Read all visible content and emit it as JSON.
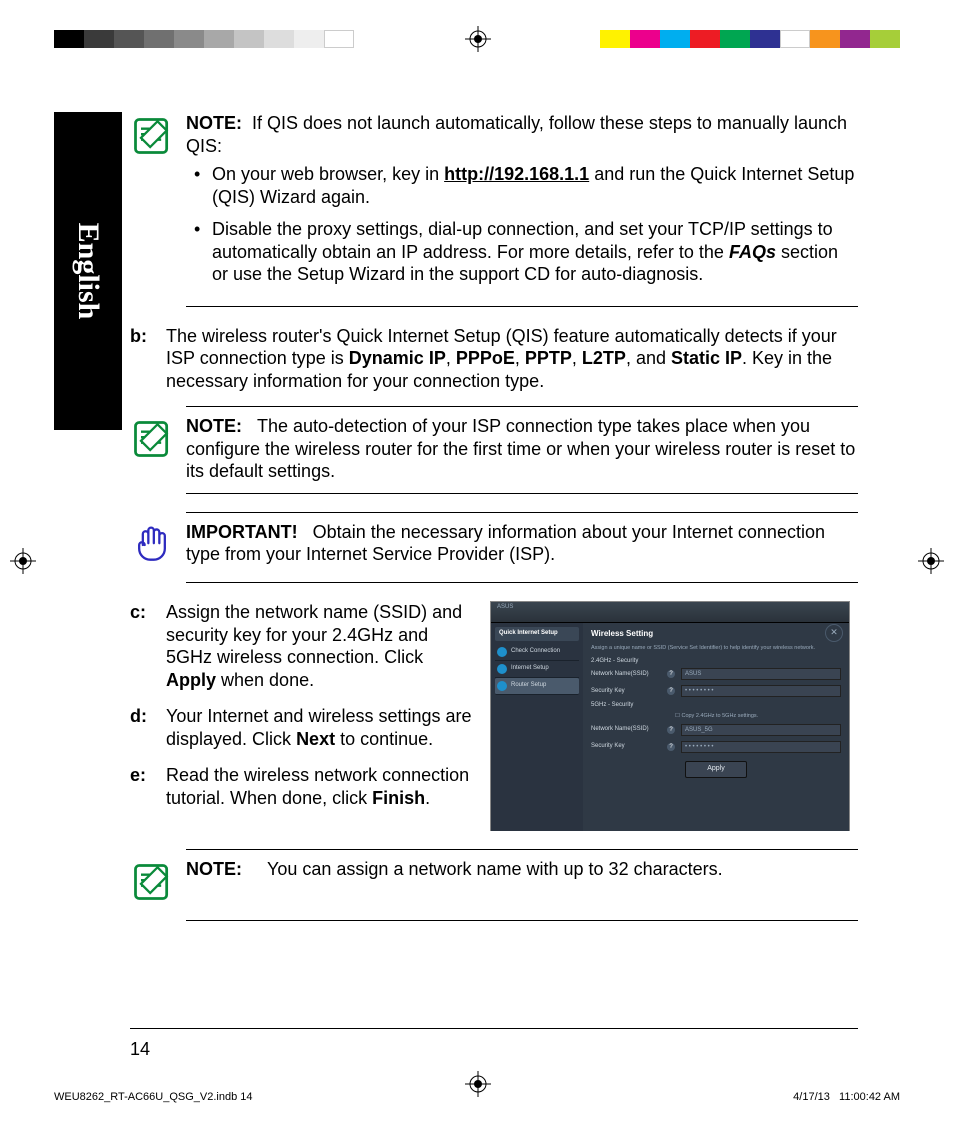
{
  "sidebar_label": "English",
  "note1": {
    "header": "NOTE:",
    "lead": "If QIS does not launch automatically, follow these steps to manually launch QIS:",
    "bullet1_pre": "On your web browser, key in ",
    "bullet1_link": "http://192.168.1.1",
    "bullet1_post": " and run the Quick Internet Setup (QIS) Wizard again.",
    "bullet2_pre": "Disable the proxy settings, dial-up connection, and set your TCP/IP settings to automatically obtain an IP address. For more details, refer to the ",
    "bullet2_bold": "FAQs",
    "bullet2_post": " section or use the Setup Wizard in the support CD for auto-diagnosis."
  },
  "step_b": {
    "letter": "b:",
    "pre": "The wireless router's Quick Internet Setup (QIS) feature automatically detects if your ISP connection type is ",
    "b1": "Dynamic IP",
    "c1": ", ",
    "b2": "PPPoE",
    "c2": ", ",
    "b3": "PPTP",
    "c3": ", ",
    "b4": "L2TP",
    "c4": ", and ",
    "b5": "Static IP",
    "post": ". Key in the necessary information for your connection type."
  },
  "note2": {
    "header": "NOTE:",
    "body": "The auto-detection of your ISP connection type takes place when you configure the wireless router for the first time or when your wireless router is reset to its default settings."
  },
  "important": {
    "header": "IMPORTANT!",
    "body": "Obtain the necessary information about your Internet connection type from your Internet Service Provider (ISP)."
  },
  "step_c": {
    "letter": "c:",
    "pre": "Assign the network name (SSID) and security key for your 2.4GHz and 5GHz wireless connection. Click ",
    "bold": "Apply",
    "post": " when done."
  },
  "step_d": {
    "letter": "d:",
    "pre": "Your Internet and wireless settings are displayed. Click ",
    "bold": "Next",
    "post": " to continue."
  },
  "step_e": {
    "letter": "e:",
    "pre": "Read the wireless network connection tutorial. When done, click ",
    "bold": "Finish",
    "post": "."
  },
  "note3": {
    "header": "NOTE:",
    "body": "You can assign a network name with up to 32 characters."
  },
  "screenshot": {
    "brand": "ASUS",
    "side_header": "Quick Internet Setup",
    "side_items": [
      "Check Connection",
      "Internet Setup",
      "Router Setup"
    ],
    "title": "Wireless Setting",
    "desc": "Assign a unique name or SSID (Service Set Identifier) to help identify your wireless network.",
    "section1": "2.4GHz - Security",
    "row1_label": "Network Name(SSID)",
    "row1_val": "ASUS",
    "row2_label": "Security Key",
    "row2_val": "• • • • • • • •",
    "section2": "5GHz - Security",
    "chk": "Copy 2.4GHz to 5GHz settings.",
    "row3_label": "Network Name(SSID)",
    "row3_val": "ASUS_5G",
    "row4_label": "Security Key",
    "row4_val": "• • • • • • • •",
    "apply": "Apply"
  },
  "page_number": "14",
  "footer_left": "WEU8262_RT-AC66U_QSG_V2.indb   14",
  "footer_date": "4/17/13",
  "footer_time": "11:00:42 AM"
}
